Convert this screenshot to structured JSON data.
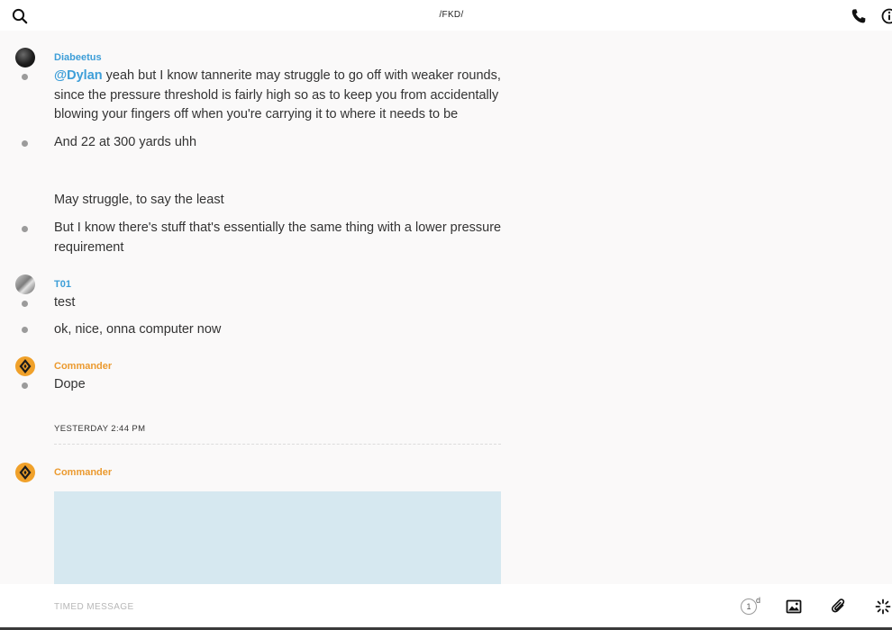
{
  "header": {
    "title": "/FKD/",
    "search_icon": "search-icon",
    "call_icon": "phone-icon",
    "info_icon": "info-icon"
  },
  "messages": [
    {
      "user": "Diabeetus",
      "user_color": "#3d9ed8",
      "avatar": "dark-avatar",
      "lines": [
        {
          "mention": "@Dylan",
          "text": " yeah but I know tannerite may struggle to go off with weaker rounds, since the pressure threshold is fairly high so as to keep you from accidentally blowing your fingers off when you're carrying it to where it needs to be"
        },
        {
          "text": "And 22 at 300 yards uhh"
        },
        {
          "text": "May struggle, to say the least"
        },
        {
          "text": "But I know there's stuff that's essentially the same thing with a lower pressure requirement"
        }
      ]
    },
    {
      "user": "T01",
      "user_color": "#3d9ed8",
      "avatar": "grey-avatar",
      "lines": [
        {
          "text": "test"
        },
        {
          "text": "ok, nice, onna computer now"
        }
      ]
    },
    {
      "user": "Commander",
      "user_color": "#eb9a2f",
      "avatar": "commander-avatar",
      "lines": [
        {
          "text": "Dope"
        }
      ]
    }
  ],
  "date_divider": "YESTERDAY 2:44 PM",
  "last_message": {
    "user": "Commander",
    "user_color": "#eb9a2f",
    "attachment": "image-attachment"
  },
  "composer": {
    "placeholder": "TIMED MESSAGE",
    "timer_value": "1",
    "timer_unit": "d",
    "image_icon": "image-icon",
    "attach_icon": "paperclip-icon",
    "more_icon": "sparkle-icon"
  },
  "colors": {
    "accent_blue": "#3d9ed8",
    "accent_orange": "#eb9a2f",
    "attachment_bg": "#d6e8f0",
    "background": "#faf9f9"
  }
}
